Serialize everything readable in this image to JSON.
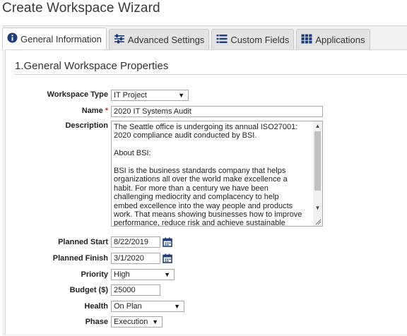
{
  "window": {
    "title": "Create Workspace Wizard"
  },
  "tabs": [
    {
      "label": "General Information",
      "icon": "info-icon",
      "active": true
    },
    {
      "label": "Advanced Settings",
      "icon": "sliders-icon",
      "active": false
    },
    {
      "label": "Custom Fields",
      "icon": "list-icon",
      "active": false
    },
    {
      "label": "Applications",
      "icon": "grid-icon",
      "active": false
    }
  ],
  "section": {
    "title": "1.General Workspace Properties"
  },
  "form": {
    "workspace_type": {
      "label": "Workspace Type",
      "value": "IT Project"
    },
    "name": {
      "label": "Name",
      "required_mark": "*",
      "value": "2020 IT Systems Audit"
    },
    "description": {
      "label": "Description",
      "value": "The Seattle office is undergoing its annual ISO27001:\n2020 compliance audit conducted by BSI.\n\nAbout BSI:\n\nBSI is the business standards company that helps\norganizations all over the world make excellence a\nhabit. For more than a century we have been\nchallenging mediocrity and complacency to help\nembed excellence into the way people and products\nwork. That means showing businesses how to improve\nperformance, reduce risk and achieve sustainable"
    },
    "planned_start": {
      "label": "Planned Start",
      "value": "8/22/2019"
    },
    "planned_finish": {
      "label": "Planned Finish",
      "value": "3/1/2020"
    },
    "priority": {
      "label": "Priority",
      "value": "High"
    },
    "budget": {
      "label": "Budget ($)",
      "value": "25000"
    },
    "health": {
      "label": "Health",
      "value": "On Plan"
    },
    "phase": {
      "label": "Phase",
      "value": "Execution"
    }
  },
  "colors": {
    "accent": "#1f3d7a",
    "required": "#c0392b",
    "tab_bg": "#e3e3e3"
  }
}
